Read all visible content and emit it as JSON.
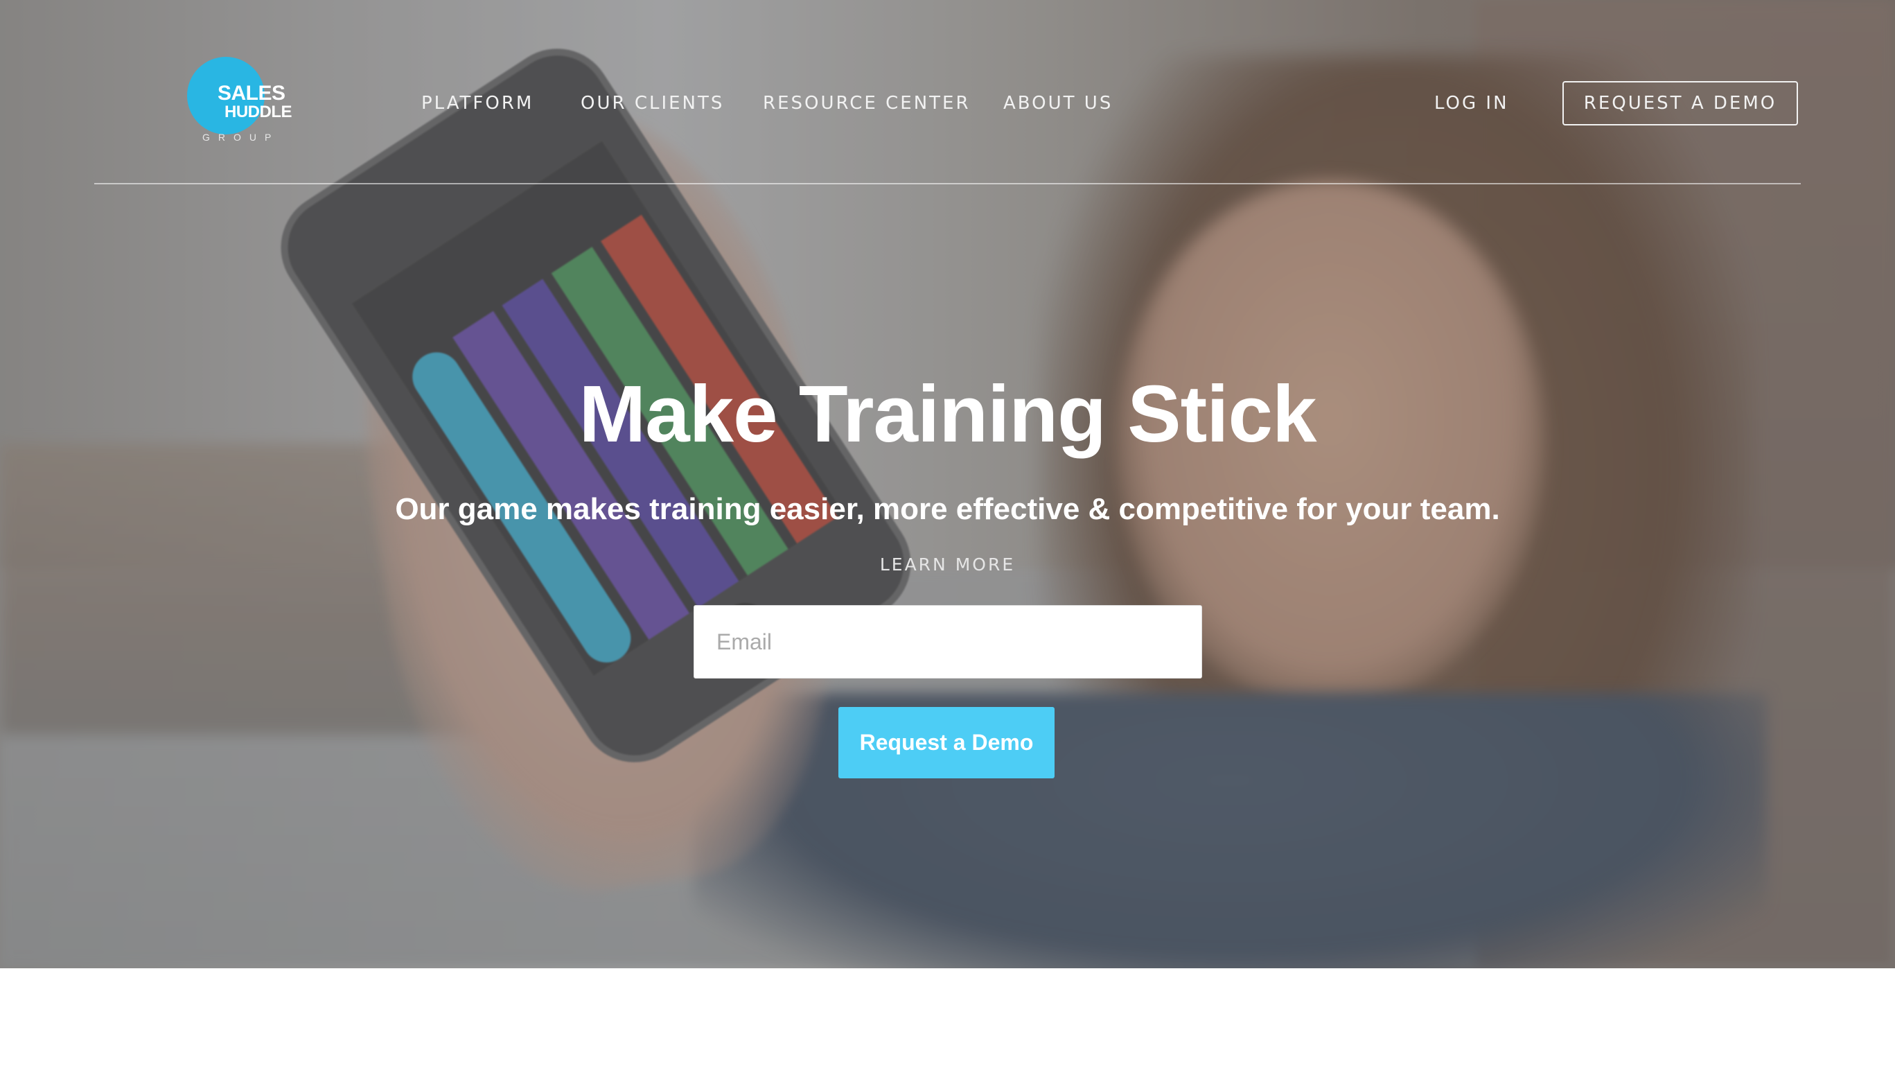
{
  "brand": {
    "logo_line1": "SALES",
    "logo_line2": "HUDDLE",
    "logo_line3": "GROUP",
    "accent_color": "#29b6e3"
  },
  "nav": {
    "items": [
      {
        "label": "PLATFORM"
      },
      {
        "label": "OUR CLIENTS"
      },
      {
        "label": "RESOURCE CENTER"
      },
      {
        "label": "ABOUT US"
      }
    ],
    "login_label": "LOG IN",
    "request_demo_label": "REQUEST A DEMO"
  },
  "hero": {
    "title": "Make Training Stick",
    "subtitle": "Our game makes training easier, more effective & competitive for your team.",
    "learn_more": "LEARN MORE",
    "email_placeholder": "Email",
    "email_value": "",
    "cta_label": "Request a Demo",
    "cta_color": "#4dcdf5"
  }
}
